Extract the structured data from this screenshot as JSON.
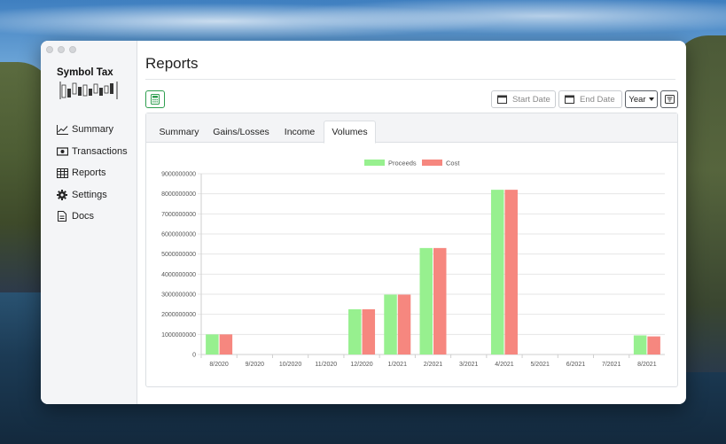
{
  "app": {
    "logo_text": "Symbol Tax"
  },
  "sidebar": {
    "items": [
      {
        "label": "Summary",
        "icon": "chart-line-icon"
      },
      {
        "label": "Transactions",
        "icon": "cash-icon"
      },
      {
        "label": "Reports",
        "icon": "table-icon"
      },
      {
        "label": "Settings",
        "icon": "gear-icon"
      },
      {
        "label": "Docs",
        "icon": "document-icon"
      }
    ]
  },
  "header": {
    "title": "Reports"
  },
  "toolbar": {
    "start_date_placeholder": "Start Date",
    "end_date_placeholder": "End Date",
    "period_value": "Year",
    "calculator_icon": "calculator-icon",
    "filter_icon": "filter-icon"
  },
  "tabs": [
    {
      "label": "Summary",
      "active": false
    },
    {
      "label": "Gains/Losses",
      "active": false
    },
    {
      "label": "Income",
      "active": false
    },
    {
      "label": "Volumes",
      "active": true
    }
  ],
  "colors": {
    "proceeds": "#97f08f",
    "cost": "#f6877f",
    "accent_green": "#2e9e4f"
  },
  "chart_data": {
    "type": "bar",
    "legend_position": "top",
    "categories": [
      "8/2020",
      "9/2020",
      "10/2020",
      "11/2020",
      "12/2020",
      "1/2021",
      "2/2021",
      "3/2021",
      "4/2021",
      "5/2021",
      "6/2021",
      "7/2021",
      "8/2021"
    ],
    "series": [
      {
        "name": "Proceeds",
        "values": [
          1000000000,
          0,
          0,
          0,
          2250000000,
          2980000000,
          5300000000,
          0,
          8200000000,
          0,
          0,
          0,
          950000000
        ]
      },
      {
        "name": "Cost",
        "values": [
          1000000000,
          0,
          0,
          0,
          2250000000,
          2980000000,
          5300000000,
          0,
          8200000000,
          0,
          0,
          0,
          900000000
        ]
      }
    ],
    "yticks": [
      "0",
      "1000000000",
      "2000000000",
      "3000000000",
      "4000000000",
      "5000000000",
      "6000000000",
      "7000000000",
      "8000000000",
      "9000000000"
    ],
    "ylim": [
      0,
      9000000000
    ],
    "grid": true
  }
}
